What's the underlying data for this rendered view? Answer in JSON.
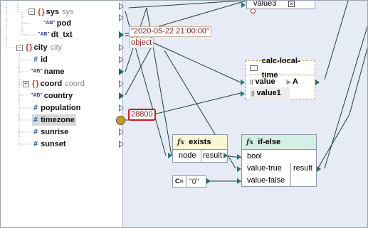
{
  "tree": {
    "sys": {
      "icon": "object-icon",
      "label": "sys",
      "type": "sys"
    },
    "pod": {
      "icon": "string-icon",
      "label": "pod"
    },
    "dt_txt": {
      "icon": "string-icon",
      "label": "dt_txt"
    },
    "city": {
      "icon": "object-icon",
      "label": "city",
      "type": "city"
    },
    "id": {
      "icon": "number-icon",
      "label": "id"
    },
    "name": {
      "icon": "string-icon",
      "label": "name"
    },
    "coord": {
      "icon": "object-icon",
      "label": "coord",
      "type": "coord"
    },
    "country": {
      "icon": "string-icon",
      "label": "country"
    },
    "population": {
      "icon": "number-icon",
      "label": "population"
    },
    "timezone": {
      "icon": "number-icon",
      "label": "timezone"
    },
    "sunrise": {
      "icon": "number-icon",
      "label": "sunrise"
    },
    "sunset": {
      "icon": "number-icon",
      "label": "sunset"
    },
    "glyphs": {
      "object": "{ }",
      "string": "\"AB\"",
      "number": "#",
      "plus": "+",
      "minus": "−"
    }
  },
  "canvas": {
    "top_value": {
      "label": "value3"
    },
    "const_datetime": "\"2020-05-22 21:00:00\"",
    "const_object": "object",
    "const_timezone": "28800",
    "calc_local_time": {
      "title": "calc-local-time",
      "in1": "value",
      "in2": "value1",
      "out": "A"
    },
    "exists": {
      "title": "exists",
      "in": "node",
      "out": "result"
    },
    "if_else": {
      "title": "if-else",
      "in1": "bool",
      "in2": "value-true",
      "in3": "value-false",
      "out": "result"
    },
    "const_zero": {
      "prefix": "C=",
      "value": "\"0\""
    },
    "fx_glyph": "fx"
  },
  "colors": {
    "canvas_bg": "#e6ebf5",
    "highlight_border": "#d0161b",
    "wire": "#1f3f3f",
    "exists_header": "#fbf6d6",
    "ifelse_header": "#d4efe4",
    "calc_border": "#b8a060"
  }
}
